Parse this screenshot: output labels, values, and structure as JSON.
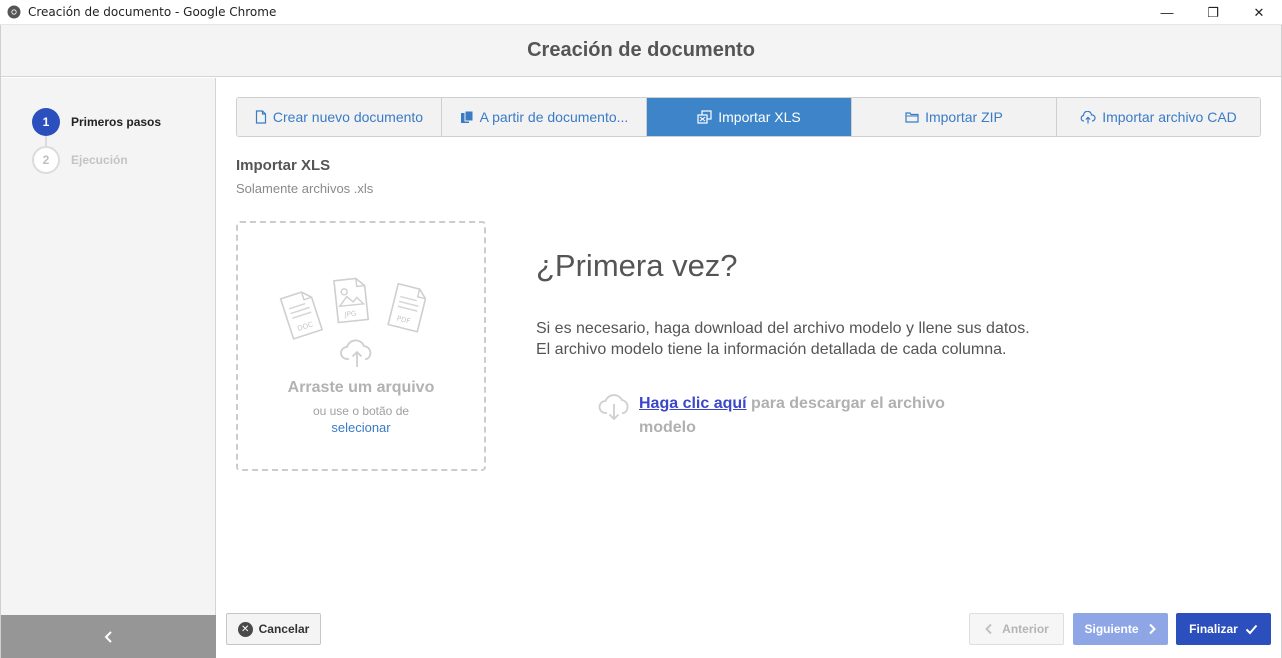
{
  "window": {
    "title": "Creación de documento - Google Chrome",
    "minimize": "—",
    "restore": "❐",
    "close": "✕"
  },
  "header": {
    "title": "Creación de documento"
  },
  "sidebar": {
    "steps": [
      {
        "number": "1",
        "label": "Primeros pasos"
      },
      {
        "number": "2",
        "label": "Ejecución"
      }
    ],
    "collapse_glyph": "‹"
  },
  "tabs": [
    {
      "label": "Crear nuevo documento",
      "icon": "document-icon"
    },
    {
      "label": "A partir de documento...",
      "icon": "copy-document-icon"
    },
    {
      "label": "Importar XLS",
      "icon": "import-xls-icon",
      "active": true
    },
    {
      "label": "Importar ZIP",
      "icon": "folder-icon"
    },
    {
      "label": "Importar archivo CAD",
      "icon": "cloud-upload-icon"
    }
  ],
  "section": {
    "title": "Importar XLS",
    "subtitle": "Solamente archivos .xls"
  },
  "dropzone": {
    "title": "Arraste um arquivo",
    "subtitle": "ou use o botão de",
    "link": "selecionar",
    "file_labels": [
      "DOC",
      "JPG",
      "PDF"
    ]
  },
  "help": {
    "heading": "¿Primera vez?",
    "line1": "Si es necesario, haga download del archivo modelo y llene sus datos.",
    "line2": "El archivo modelo tiene la información detallada de cada columna.",
    "download_link": "Haga clic aquí",
    "download_rest": " para descargar el archivo modelo"
  },
  "footer": {
    "cancel": "Cancelar",
    "previous": "Anterior",
    "next": "Siguiente",
    "finish": "Finalizar"
  },
  "colors": {
    "primary": "#2b4fbd",
    "tab_active": "#3d84c9",
    "link": "#3a7bc6",
    "next_disabled": "#8fa6e6"
  }
}
